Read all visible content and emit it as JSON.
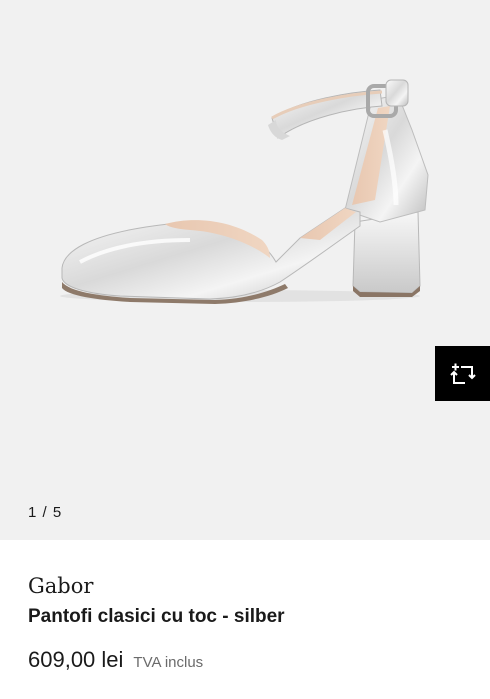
{
  "gallery": {
    "counter": "1 / 5",
    "image_subject": "silver-pump-shoe",
    "compare_icon": "add-to-compare-icon"
  },
  "product": {
    "brand": "Gabor",
    "title": "Pantofi clasici cu toc - silber",
    "price": "609,00 lei",
    "vat_note": "TVA inclus"
  },
  "colors": {
    "gallery_bg": "#f1f1f1",
    "compare_bg": "#000000",
    "text": "#1a1a1a",
    "muted": "#6b6b6b"
  }
}
